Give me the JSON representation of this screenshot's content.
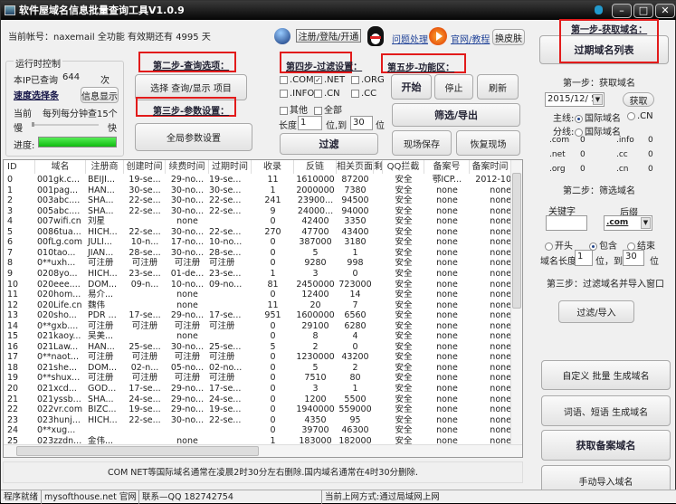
{
  "title": "软件屋域名信息批量查询工具V1.0.9",
  "account": "当前帐号：naxemail 全功能 有效期还有 4995 天",
  "runtime": {
    "group": "运行时控制",
    "ip_label": "本IP已查询",
    "ip_count": "644",
    "ip_unit": "次",
    "speed_link": "速度选择条",
    "info_btn": "信息显示",
    "current_label": "当前",
    "current_value": "每列每分钟查15个",
    "slow": "慢",
    "fast": "快",
    "progress_label": "进度:",
    "progress": 100
  },
  "step2": {
    "label": "第二步-查询选项：",
    "button": "选择 查询/显示 项目"
  },
  "step3": {
    "label": "第三步-参数设置：",
    "button": "全局参数设置"
  },
  "header": {
    "register_btn": "注册/登陆/开通",
    "help_link": "问题处理",
    "site_link": "官网/教程",
    "skin_btn": "换皮肤"
  },
  "step4": {
    "label": "第四步-过滤设置：",
    "checkboxes": [
      {
        "label": ".COM",
        "checked": false
      },
      {
        "label": ".NET",
        "checked": true
      },
      {
        "label": ".ORG",
        "checked": false
      },
      {
        "label": ".INFO",
        "checked": false
      },
      {
        "label": ".CN",
        "checked": false
      },
      {
        "label": ".CC",
        "checked": false
      },
      {
        "label": "其他",
        "checked": false
      },
      {
        "label": "全部",
        "checked": false
      }
    ],
    "length_label": "长度",
    "min": "1",
    "to_label": "位,到",
    "max": "30",
    "unit": "位",
    "filter_btn": "过滤"
  },
  "step5": {
    "label": "第五步-功能区：",
    "start": "开始",
    "stop": "停止",
    "refresh": "刷新",
    "export": "筛选/导出",
    "save": "现场保存",
    "restore": "恢复现场"
  },
  "table": {
    "headers": [
      "ID",
      "域名",
      "注册商",
      "创建时间",
      "续费时间",
      "过期时间",
      "收录",
      "反链",
      "相关页面",
      "剩",
      "QQ拦截",
      "备案号",
      "备案时间"
    ],
    "rows": [
      [
        "0",
        "001gk.c...",
        "BEIJI...",
        "19-se...",
        "29-no...",
        "19-se...",
        "11",
        "1610000",
        "87200",
        "",
        "安全",
        "鄂ICP...",
        "2012-10"
      ],
      [
        "1",
        "001pag...",
        "HAN...",
        "30-se...",
        "30-no...",
        "30-se...",
        "1",
        "2000000",
        "7380",
        "",
        "安全",
        "none",
        "none"
      ],
      [
        "2",
        "003abc....",
        "SHA...",
        "22-se...",
        "30-no...",
        "22-se...",
        "241",
        "23900...",
        "94500",
        "",
        "安全",
        "none",
        "none"
      ],
      [
        "3",
        "005abc....",
        "SHA...",
        "22-se...",
        "30-no...",
        "22-se...",
        "9",
        "24000...",
        "94000",
        "",
        "安全",
        "none",
        "none"
      ],
      [
        "4",
        "007wifi.cn",
        "刘星",
        "",
        "none",
        "",
        "0",
        "42400",
        "3350",
        "",
        "安全",
        "none",
        "none"
      ],
      [
        "5",
        "0086tua...",
        "HICH...",
        "22-se...",
        "30-no...",
        "22-se...",
        "270",
        "47700",
        "43400",
        "",
        "安全",
        "none",
        "none"
      ],
      [
        "6",
        "00fLg.com",
        "JULI...",
        "10-n...",
        "17-no...",
        "10-no...",
        "0",
        "387000",
        "3180",
        "",
        "安全",
        "none",
        "none"
      ],
      [
        "7",
        "010tao...",
        "JIAN...",
        "28-se...",
        "30-no...",
        "28-se...",
        "0",
        "5",
        "1",
        "",
        "安全",
        "none",
        "none"
      ],
      [
        "8",
        "0**uxh...",
        "可注册",
        "可注册",
        "可注册",
        "可注册",
        "0",
        "9280",
        "998",
        "",
        "安全",
        "none",
        "none"
      ],
      [
        "9",
        "0208yo...",
        "HICH...",
        "23-se...",
        "01-de...",
        "23-se...",
        "1",
        "3",
        "0",
        "",
        "安全",
        "none",
        "none"
      ],
      [
        "10",
        "020eee....",
        "DOM...",
        "09-n...",
        "10-no...",
        "09-no...",
        "81",
        "2450000",
        "723000",
        "",
        "安全",
        "none",
        "none"
      ],
      [
        "11",
        "020hom...",
        "易介...",
        "",
        "none",
        "",
        "0",
        "12400",
        "14",
        "",
        "安全",
        "none",
        "none"
      ],
      [
        "12",
        "020Life.cn",
        "魏伟",
        "",
        "none",
        "",
        "11",
        "20",
        "7",
        "",
        "安全",
        "none",
        "none"
      ],
      [
        "13",
        "020sho...",
        "PDR ...",
        "17-se...",
        "29-no...",
        "17-se...",
        "951",
        "1600000",
        "6560",
        "",
        "安全",
        "none",
        "none"
      ],
      [
        "14",
        "0**gxb....",
        "可注册",
        "可注册",
        "可注册",
        "可注册",
        "0",
        "29100",
        "6280",
        "",
        "安全",
        "none",
        "none"
      ],
      [
        "15",
        "021kaoy...",
        "吴美...",
        "",
        "none",
        "",
        "0",
        "8",
        "4",
        "",
        "安全",
        "none",
        "none"
      ],
      [
        "16",
        "021Law...",
        "HAN...",
        "25-se...",
        "30-no...",
        "25-se...",
        "5",
        "2",
        "0",
        "",
        "安全",
        "none",
        "none"
      ],
      [
        "17",
        "0**naot...",
        "可注册",
        "可注册",
        "可注册",
        "可注册",
        "0",
        "1230000",
        "43200",
        "",
        "安全",
        "none",
        "none"
      ],
      [
        "18",
        "021she...",
        "DOM...",
        "02-n...",
        "05-no...",
        "02-no...",
        "0",
        "5",
        "2",
        "",
        "安全",
        "none",
        "none"
      ],
      [
        "19",
        "0**shux...",
        "可注册",
        "可注册",
        "可注册",
        "可注册",
        "0",
        "7510",
        "80",
        "",
        "安全",
        "none",
        "none"
      ],
      [
        "20",
        "021xcd...",
        "GOD...",
        "17-se...",
        "29-no...",
        "17-se...",
        "0",
        "3",
        "1",
        "",
        "安全",
        "none",
        "none"
      ],
      [
        "21",
        "021yssb...",
        "SHA...",
        "24-se...",
        "29-no...",
        "24-se...",
        "0",
        "1200",
        "5500",
        "",
        "安全",
        "none",
        "none"
      ],
      [
        "22",
        "022vr.com",
        "BIZC...",
        "19-se...",
        "29-no...",
        "19-se...",
        "0",
        "1940000",
        "559000",
        "",
        "安全",
        "none",
        "none"
      ],
      [
        "23",
        "023hunj...",
        "HICH...",
        "22-se...",
        "30-no...",
        "22-se...",
        "0",
        "4350",
        "95",
        "",
        "安全",
        "none",
        "none"
      ],
      [
        "24",
        "0**xug...",
        "",
        "",
        "",
        "",
        "0",
        "39700",
        "46300",
        "",
        "安全",
        "none",
        "none"
      ],
      [
        "25",
        "023zzdn...",
        "金伟...",
        "",
        "none",
        "",
        "1",
        "183000",
        "182000",
        "",
        "安全",
        "none",
        "none"
      ]
    ]
  },
  "notice": "COM NET等国际域名通常在凌晨2时30分左右删除.国内域名通常在4时30分删除.",
  "right": {
    "step1_label": "第一步-获取域名：",
    "expired_btn": "过期域名列表",
    "step1_title": "第一步：获取域名",
    "date": "2015/12/ 5",
    "fetch_btn": "获取",
    "main_label": "主线:",
    "main_opt1": "国际域名",
    "main_opt2": ".CN",
    "branch_label": "分线:",
    "branch_opt": "国际域名",
    "counts": [
      [
        ".com",
        "0",
        ".info",
        "0"
      ],
      [
        ".net",
        "0",
        ".cc",
        "0"
      ],
      [
        ".org",
        "0",
        ".cn",
        "0"
      ]
    ],
    "step2_title": "第二步：筛选域名",
    "keyword_label": "关键字",
    "suffix_label": "后缀",
    "keyword": "",
    "suffix": ".com",
    "pos_start": "开头",
    "pos_contain": "包含",
    "pos_end": "结束",
    "len_label": "域名长度",
    "len_min": "1",
    "len_to": "位，到",
    "len_max": "30",
    "len_unit": "位",
    "step3_title": "第三步：过滤域名并导入窗口",
    "filter_import": "过滤/导入",
    "custom_btn": "自定义 批量 生成域名",
    "words_btn": "词语、短语 生成域名",
    "beian_btn": "获取备案域名",
    "manual_btn": "手动导入域名"
  },
  "status": {
    "ready": "程序就绪",
    "site": "mysofthouse.net 官网",
    "contact": "联系—QQ 182742754",
    "net": "当前上网方式:通过局域网上网"
  }
}
